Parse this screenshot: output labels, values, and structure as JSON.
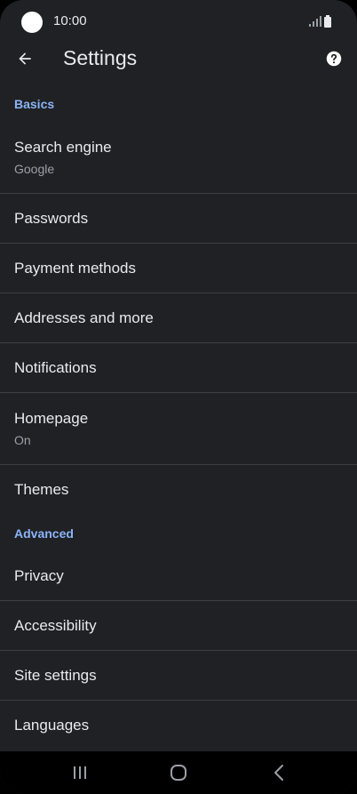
{
  "status": {
    "time": "10:00"
  },
  "header": {
    "title": "Settings"
  },
  "sections": {
    "basics": {
      "label": "Basics",
      "items": [
        {
          "title": "Search engine",
          "subtitle": "Google"
        },
        {
          "title": "Passwords"
        },
        {
          "title": "Payment methods"
        },
        {
          "title": "Addresses and more"
        },
        {
          "title": "Notifications"
        },
        {
          "title": "Homepage",
          "subtitle": "On"
        },
        {
          "title": "Themes"
        }
      ]
    },
    "advanced": {
      "label": "Advanced",
      "items": [
        {
          "title": "Privacy"
        },
        {
          "title": "Accessibility"
        },
        {
          "title": "Site settings"
        },
        {
          "title": "Languages"
        }
      ]
    }
  },
  "icons": {
    "back": "arrow-back-icon",
    "help": "help-icon",
    "signal": "signal-icon",
    "battery": "battery-icon",
    "recents": "recents-icon",
    "home": "home-icon",
    "nav_back": "nav-back-icon"
  },
  "colors": {
    "background": "#202124",
    "accent": "#8ab4f8",
    "text_primary": "#e8eaed",
    "text_secondary": "#9aa0a6",
    "divider": "#3c4043"
  }
}
